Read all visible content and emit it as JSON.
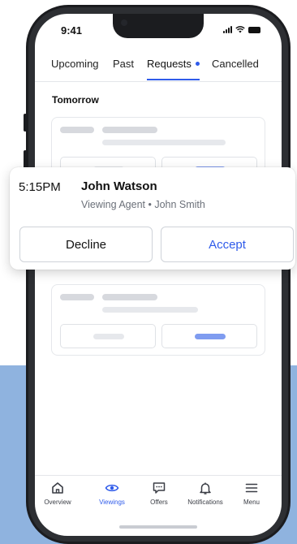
{
  "colors": {
    "accent": "#2f5bea",
    "backdrop": "#8fb3df",
    "phone_frame": "#1b1c1f"
  },
  "status_bar": {
    "time": "9:41",
    "icons": [
      "cellular-signal-icon",
      "wifi-icon",
      "battery-icon"
    ]
  },
  "tabs": [
    {
      "label": "Upcoming",
      "active": false
    },
    {
      "label": "Past",
      "active": false
    },
    {
      "label": "Requests",
      "active": true,
      "has_dot": true
    },
    {
      "label": "Cancelled",
      "active": false
    }
  ],
  "section_title": "Tomorrow",
  "popup": {
    "time": "5:15PM",
    "name": "John Watson",
    "subtitle": "Viewing Agent • John Smith",
    "decline_label": "Decline",
    "accept_label": "Accept"
  },
  "bottom_nav": [
    {
      "label": "Overview",
      "icon": "home-icon",
      "active": false
    },
    {
      "label": "Viewings",
      "icon": "eye-icon",
      "active": true
    },
    {
      "label": "Offers",
      "icon": "chat-offer-icon",
      "active": false
    },
    {
      "label": "Notifications",
      "icon": "bell-icon",
      "active": false
    },
    {
      "label": "Menu",
      "icon": "hamburger-menu-icon",
      "active": false
    }
  ]
}
